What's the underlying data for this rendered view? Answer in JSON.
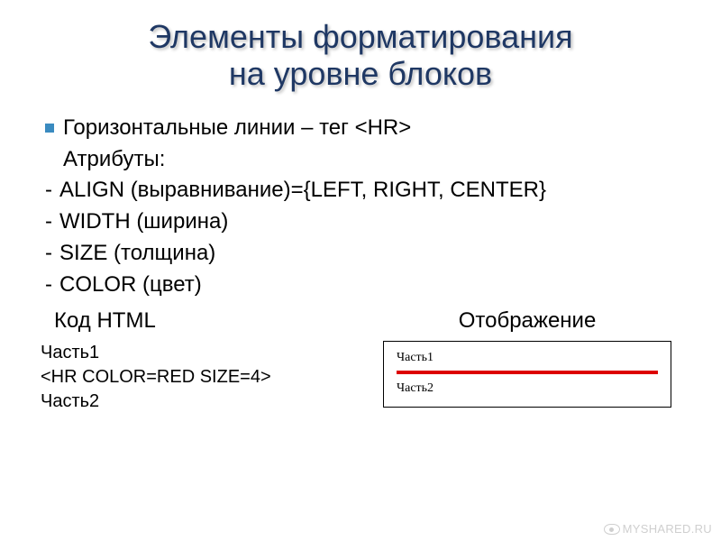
{
  "title_line1": "Элементы форматирования",
  "title_line2": "на уровне блоков",
  "bullets": {
    "main": "Горизонтальные линии – тег <HR>",
    "attrs_label": "Атрибуты:",
    "items": [
      "ALIGN (выравнивание)={LEFT, RIGHT, CENTER}",
      "WIDTH (ширина)",
      "SIZE (толщина)",
      "COLOR (цвет)"
    ]
  },
  "example": {
    "left_heading": "Код HTML",
    "right_heading": "Отображение",
    "code_lines": [
      "Часть1",
      "<HR COLOR=RED SIZE=4>",
      "Часть2"
    ],
    "render": {
      "line1": "Часть1",
      "line2": "Часть2",
      "hr_color": "#d00",
      "hr_size_px": 4
    }
  },
  "watermark": "MYSHARED.RU"
}
